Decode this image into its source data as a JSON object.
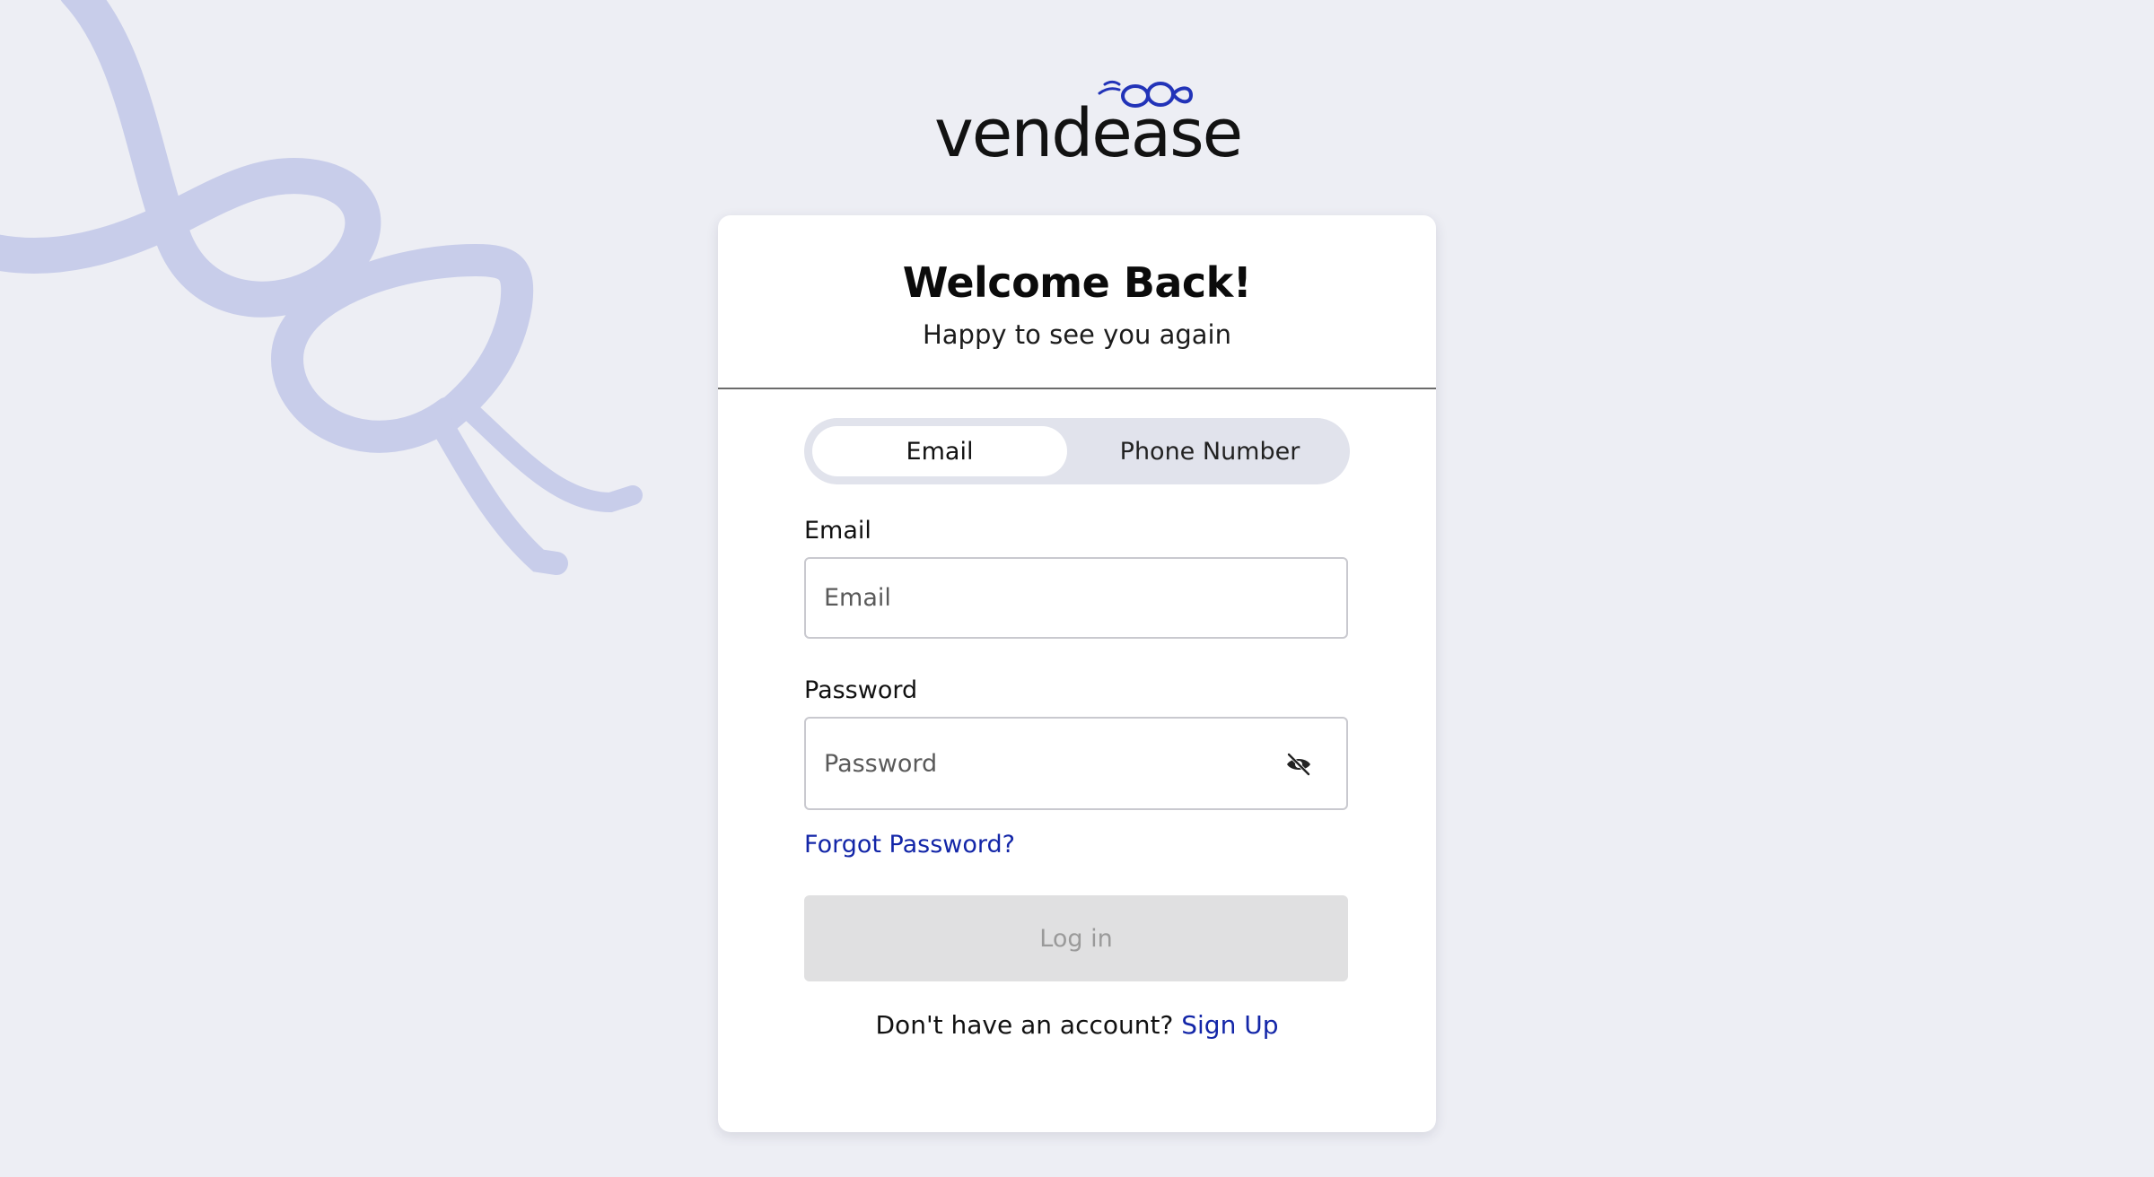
{
  "brand": {
    "name": "vendease",
    "accent_color": "#2233b8",
    "ribbon_color": "#c8cdea"
  },
  "card": {
    "title": "Welcome Back!",
    "subtitle": "Happy to see you again"
  },
  "login_method": {
    "options": [
      "Email",
      "Phone Number"
    ],
    "selected": "Email"
  },
  "email_field": {
    "label": "Email",
    "placeholder": "Email",
    "value": ""
  },
  "password_field": {
    "label": "Password",
    "placeholder": "Password",
    "value": "",
    "visibility_icon": "eye-off-icon"
  },
  "forgot_password_label": "Forgot Password?",
  "login_button_label": "Log in",
  "login_button_state": "disabled",
  "signup": {
    "prompt": "Don't have an account?",
    "link_label": "Sign Up"
  }
}
